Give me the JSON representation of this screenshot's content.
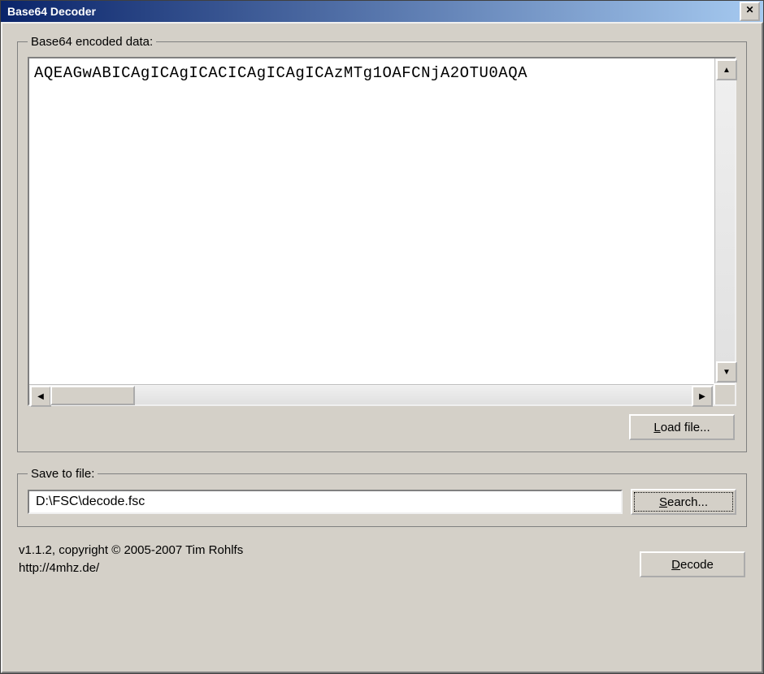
{
  "window": {
    "title": "Base64 Decoder"
  },
  "encoded": {
    "legend": "Base64 encoded data:",
    "content": "AQEAGwABICAgICAgICACICAgICAgICAzMTg1OAFCNjA2OTU0AQA",
    "load_file_label": "Load file..."
  },
  "save": {
    "legend": "Save to file:",
    "path": "D:\\FSC\\decode.fsc",
    "search_label": "Search..."
  },
  "footer": {
    "line1": "v1.1.2, copyright © 2005-2007 Tim Rohlfs",
    "line2": "http://4mhz.de/",
    "decode_label": "Decode"
  }
}
